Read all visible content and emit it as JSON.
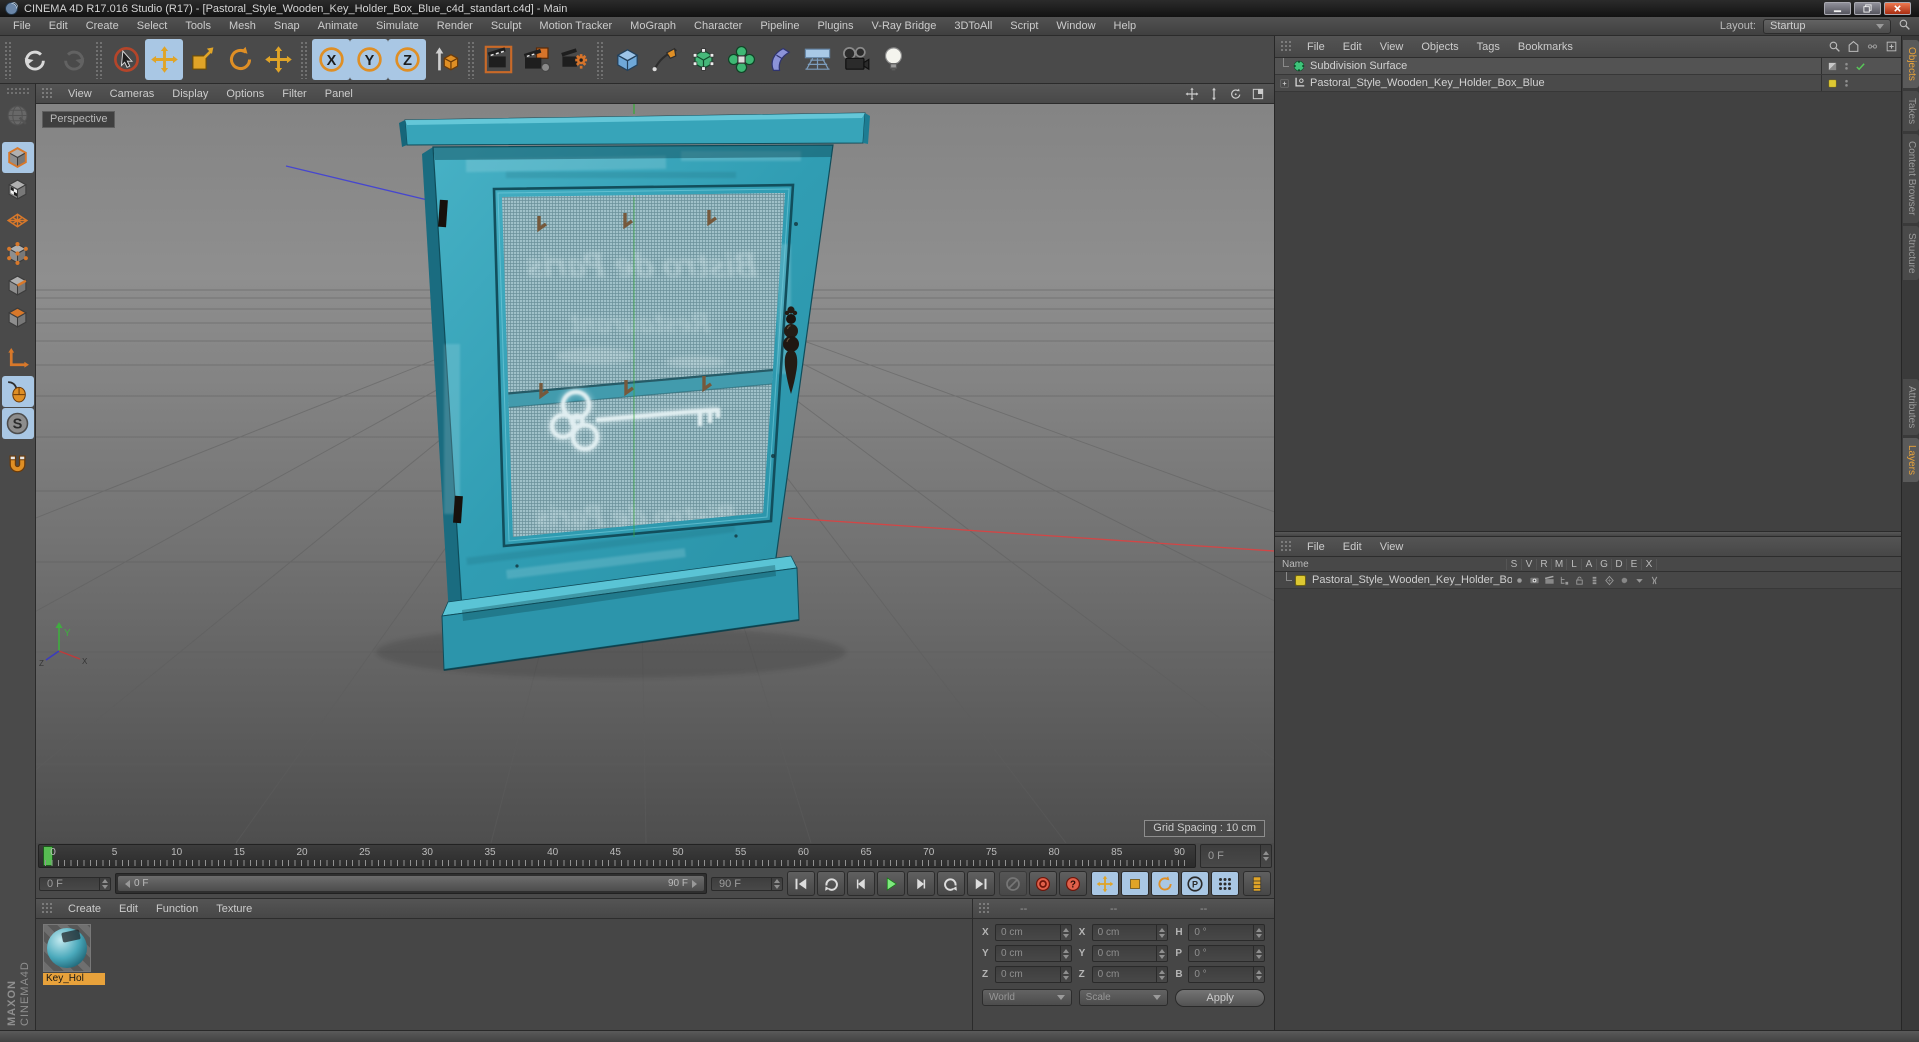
{
  "window": {
    "title": "CINEMA 4D R17.016 Studio (R17) - [Pastoral_Style_Wooden_Key_Holder_Box_Blue_c4d_standart.c4d] - Main"
  },
  "menubar": {
    "items": [
      "File",
      "Edit",
      "Create",
      "Select",
      "Tools",
      "Mesh",
      "Snap",
      "Animate",
      "Simulate",
      "Render",
      "Sculpt",
      "Motion Tracker",
      "MoGraph",
      "Character",
      "Pipeline",
      "Plugins",
      "V-Ray Bridge",
      "3DToAll",
      "Script",
      "Window",
      "Help"
    ],
    "layout_label": "Layout:",
    "layout_value": "Startup"
  },
  "toolbar": {
    "buttons": [
      {
        "gap": true
      },
      {
        "name": "undo"
      },
      {
        "name": "redo",
        "disabled": true
      },
      {
        "gap": true
      },
      {
        "name": "live-selection"
      },
      {
        "name": "move",
        "active": true
      },
      {
        "name": "scale"
      },
      {
        "name": "rotate"
      },
      {
        "name": "last-tool"
      },
      {
        "gap": true
      },
      {
        "name": "axis-x",
        "active": true
      },
      {
        "name": "axis-y",
        "active": true
      },
      {
        "name": "axis-z",
        "active": true
      },
      {
        "name": "coord-system"
      },
      {
        "gap": true
      },
      {
        "name": "render-view"
      },
      {
        "name": "render-picture"
      },
      {
        "name": "render-settings"
      },
      {
        "gap": true
      },
      {
        "name": "add-cube"
      },
      {
        "name": "add-spline"
      },
      {
        "name": "subdivision-surface"
      },
      {
        "name": "generators"
      },
      {
        "name": "deformer"
      },
      {
        "name": "environment"
      },
      {
        "name": "camera"
      },
      {
        "name": "light"
      }
    ]
  },
  "palette": {
    "buttons": [
      {
        "name": "make-editable",
        "disabled": true
      },
      {
        "gap": true
      },
      {
        "name": "model-mode",
        "active": true
      },
      {
        "name": "texture-mode"
      },
      {
        "name": "workplane"
      },
      {
        "name": "points-mode"
      },
      {
        "name": "edges-mode"
      },
      {
        "name": "polygons-mode"
      },
      {
        "gap": true
      },
      {
        "name": "axis-mode"
      },
      {
        "name": "tweak-mouse",
        "active": true
      },
      {
        "name": "snap",
        "active": true
      },
      {
        "gap": true
      },
      {
        "name": "magnet"
      }
    ]
  },
  "viewport": {
    "menu": [
      "View",
      "Cameras",
      "Display",
      "Options",
      "Filter",
      "Panel"
    ],
    "nav": [
      {
        "name": "pan"
      },
      {
        "name": "dolly"
      },
      {
        "name": "orbit"
      },
      {
        "name": "toggle-view"
      }
    ],
    "camera_label": "Perspective",
    "grid_label": "Grid Spacing : 10 cm",
    "axis": {
      "x": "X",
      "y": "Y",
      "z": "Z"
    },
    "model": {
      "description": "Pastoral style wooden key holder box, blue, with mesh door, key hooks and metal handle",
      "texts": [
        "Bistro de Paris",
        "Restaurant",
        "Bistro de Paris"
      ]
    }
  },
  "timeline": {
    "ticks": [
      "0",
      "5",
      "10",
      "15",
      "20",
      "25",
      "30",
      "35",
      "40",
      "45",
      "50",
      "55",
      "60",
      "65",
      "70",
      "75",
      "80",
      "85",
      "90"
    ],
    "current_field": "0 F",
    "start_field": "0 F",
    "range_start": "0 F",
    "range_end": "90 F",
    "end_field": "90 F",
    "transport": [
      {
        "name": "goto-start"
      },
      {
        "name": "cycle"
      },
      {
        "name": "prev-frame"
      },
      {
        "name": "play"
      },
      {
        "name": "next-frame"
      },
      {
        "name": "loop"
      },
      {
        "name": "goto-end"
      }
    ],
    "record": [
      {
        "name": "record-disabled",
        "dim": true
      },
      {
        "name": "record"
      },
      {
        "name": "autokey-help"
      }
    ],
    "keyframe": [
      {
        "name": "kf-position",
        "blue": true
      },
      {
        "name": "kf-scale",
        "blue": true
      },
      {
        "name": "kf-rotation",
        "blue": true
      },
      {
        "name": "kf-parameter",
        "blue": true
      },
      {
        "name": "kf-pla",
        "blue": true
      }
    ],
    "kf_sel": [
      {
        "name": "kf-selection"
      }
    ]
  },
  "materials": {
    "menu": [
      "Create",
      "Edit",
      "Function",
      "Texture"
    ],
    "label": "Key_Hol"
  },
  "coordinates": {
    "dashes": [
      "--",
      "--",
      "--"
    ],
    "pos_labels": [
      "X",
      "Y",
      "Z"
    ],
    "pos": [
      "0 cm",
      "0 cm",
      "0 cm"
    ],
    "size_labels": [
      "X",
      "Y",
      "Z"
    ],
    "size": [
      "0 cm",
      "0 cm",
      "0 cm"
    ],
    "rot_labels": [
      "H",
      "P",
      "B"
    ],
    "rot": [
      "0 °",
      "0 °",
      "0 °"
    ],
    "world": "World",
    "scale": "Scale",
    "apply": "Apply"
  },
  "object_manager": {
    "menu": [
      "File",
      "Edit",
      "View",
      "Objects",
      "Tags",
      "Bookmarks"
    ],
    "corner": [
      {
        "name": "search"
      },
      {
        "name": "bookmark-home"
      },
      {
        "name": "link-small"
      },
      {
        "name": "add-panel"
      }
    ],
    "row1": "Subdivision Surface",
    "row2": "Pastoral_Style_Wooden_Key_Holder_Box_Blue"
  },
  "layers_panel": {
    "menu": [
      "File",
      "Edit",
      "View"
    ],
    "name_header": "Name",
    "columns": [
      "S",
      "V",
      "R",
      "M",
      "L",
      "A",
      "G",
      "D",
      "E",
      "X"
    ],
    "row_name": "Pastoral_Style_Wooden_Key_Holder_Box_Blue",
    "cells": [
      "cell-dot",
      "cell-eye",
      "cell-clapper",
      "cell-tree",
      "cell-lock",
      "cell-bars",
      "cell-diamond",
      "cell-blob",
      "cell-arrow",
      "cell-bones"
    ]
  },
  "right_tabs": [
    {
      "label": "Objects",
      "active": true
    },
    {
      "label": "Takes"
    },
    {
      "label": "Content Browser"
    },
    {
      "label": "Structure"
    },
    {
      "label": "Attributes",
      "gap_before": 96
    },
    {
      "label": "Layers",
      "active": true
    }
  ],
  "branding": {
    "line1": "MAXON",
    "line2": "CINEMA4D"
  },
  "colors": {
    "accent_orange": "#e8a33b",
    "active_blue": "#a9c7e4",
    "teal_model": "#2f9cb2",
    "playhead_green": "#57bd52",
    "record_red": "#e0604a",
    "layer_yellow": "#ddc832"
  }
}
